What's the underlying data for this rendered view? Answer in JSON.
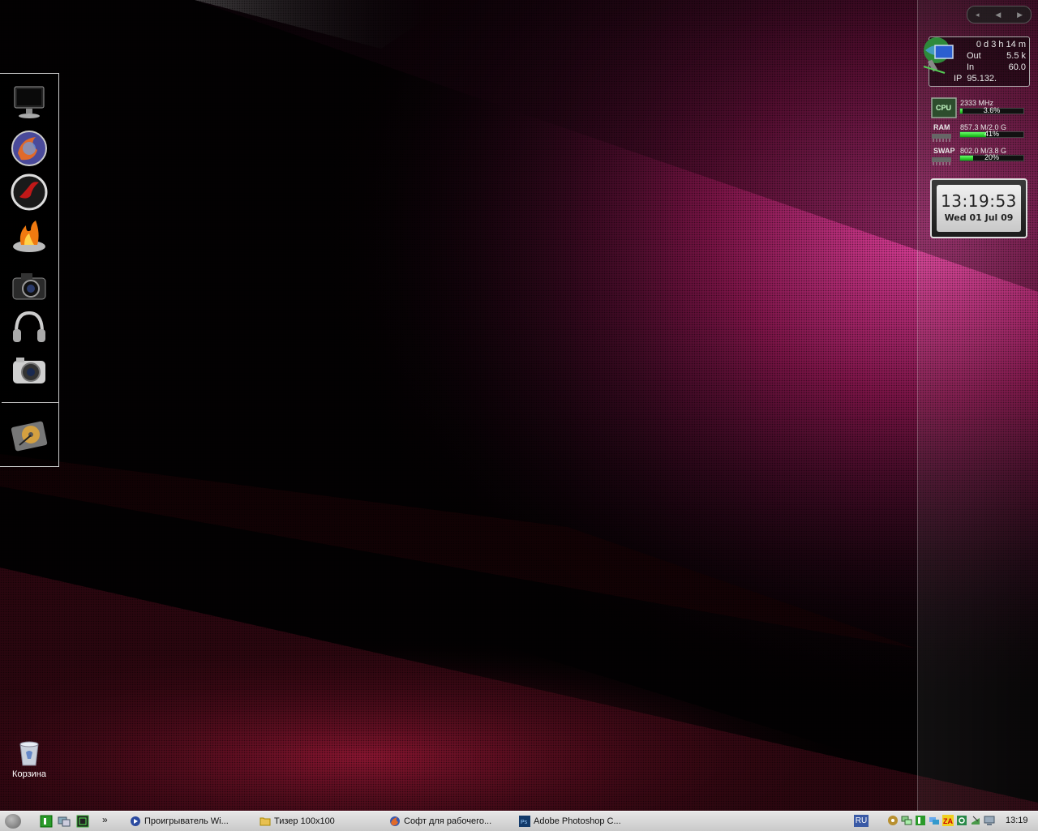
{
  "desktop": {
    "dock": {
      "items": [
        {
          "icon": "monitor-icon"
        },
        {
          "icon": "firefox-icon"
        },
        {
          "icon": "flash-icon"
        },
        {
          "icon": "burning-disc-icon"
        },
        {
          "icon": "camera-icon"
        },
        {
          "icon": "headphones-icon"
        },
        {
          "icon": "photo-camera-icon"
        },
        {
          "icon": "hard-drive-icon"
        }
      ]
    },
    "recycle_bin": {
      "label": "Корзина",
      "icon": "recycle-bin-icon"
    }
  },
  "sidebar": {
    "nav": {
      "prev_label": "◂",
      "back_label": "◀",
      "next_label": "▶"
    },
    "network": {
      "uptime": "0 d 3 h 14 m",
      "out_label": "Out",
      "out_value": "5.5 k",
      "in_label": "In",
      "in_value": "60.0",
      "ip_label": "IP",
      "ip_value": "95.132."
    },
    "system": {
      "cpu_label": "CPU",
      "cpu_freq": "2333 MHz",
      "cpu_percent": "3.6%",
      "cpu_fraction": 0.036,
      "ram_label": "RAM",
      "ram_value": "857.3 M/2.0 G",
      "ram_percent": "41%",
      "ram_fraction": 0.41,
      "swap_label": "SWAP",
      "swap_value": "802.0 M/3.8 G",
      "swap_percent": "20%",
      "swap_fraction": 0.2
    },
    "clock": {
      "time": "13:19:53",
      "date": "Wed 01 Jul 09"
    }
  },
  "taskbar": {
    "quick_launch": [
      "green-app-icon",
      "network-monitor-icon",
      "screen-capture-icon"
    ],
    "overflow_label": "»",
    "tasks": [
      {
        "label": "Проигрыватель Wi...",
        "icon": "media-player-icon"
      },
      {
        "label": "Тизер 100x100",
        "icon": "folder-icon"
      },
      {
        "label": "Софт для рабочего...",
        "icon": "firefox-icon"
      },
      {
        "label": "Adobe Photoshop C...",
        "icon": "photoshop-icon"
      }
    ],
    "language": "RU",
    "tray": [
      "audio-icon",
      "network-icon",
      "green-status-icon",
      "connection-icon",
      "zonealarm-icon",
      "sync-icon",
      "download-icon",
      "pc-icon"
    ],
    "clock": "13:19"
  },
  "colors": {
    "accent": "#c2185b",
    "taskbar": "#d6d6d6",
    "lang_badge": "#3a5aa6"
  }
}
